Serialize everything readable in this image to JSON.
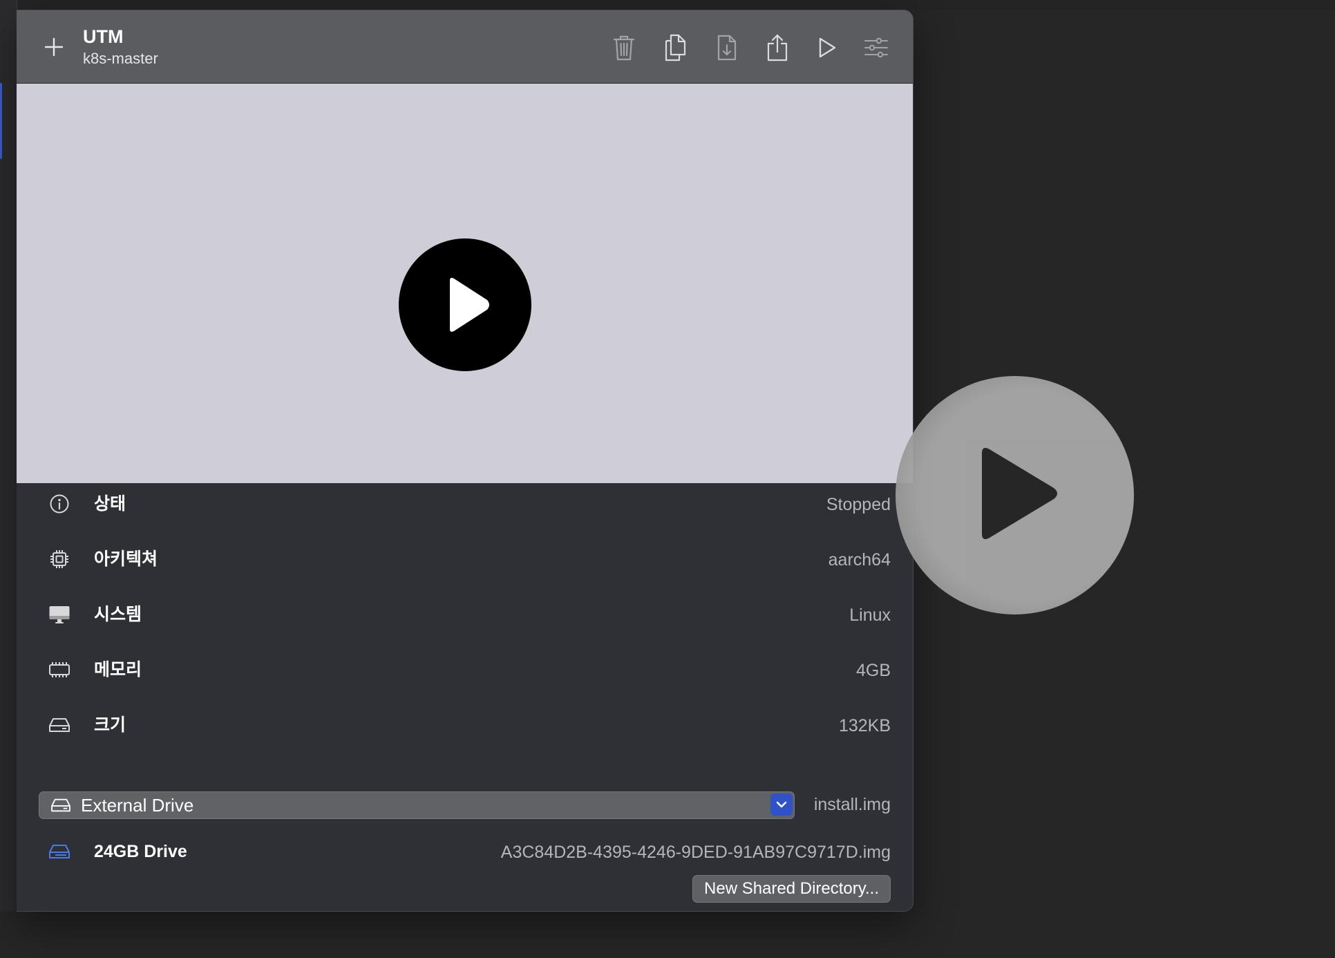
{
  "window": {
    "title": "UTM",
    "subtitle": "k8s-master"
  },
  "toolbar": {
    "add_icon": "plus-icon",
    "actions": [
      {
        "name": "delete",
        "icon": "trash-icon"
      },
      {
        "name": "clone",
        "icon": "copy-icon"
      },
      {
        "name": "move",
        "icon": "document-download-icon"
      },
      {
        "name": "share",
        "icon": "share-icon"
      },
      {
        "name": "run",
        "icon": "play-icon"
      },
      {
        "name": "settings",
        "icon": "sliders-icon"
      }
    ]
  },
  "preview": {
    "play_icon": "play-circle-icon",
    "background": "#cfcdd8"
  },
  "details": {
    "rows": [
      {
        "icon": "info-icon",
        "label": "상태",
        "value": "Stopped"
      },
      {
        "icon": "cpu-icon",
        "label": "아키텍쳐",
        "value": "aarch64"
      },
      {
        "icon": "display-icon",
        "label": "시스템",
        "value": "Linux"
      },
      {
        "icon": "memory-icon",
        "label": "메모리",
        "value": "4GB"
      },
      {
        "icon": "drive-icon",
        "label": "크기",
        "value": "132KB"
      }
    ],
    "external_drive": {
      "icon": "drive-icon",
      "selected": "External Drive",
      "value": "install.img"
    },
    "drive": {
      "icon": "drive-icon",
      "label": "24GB Drive",
      "value": "A3C84D2B-4395-4246-9DED-91AB97C9717D.img"
    },
    "shared_directory_button": "New Shared Directory..."
  },
  "colors": {
    "accent": "#2f52c6",
    "toolbar": "#5b5c60",
    "panel": "#2e3036"
  }
}
